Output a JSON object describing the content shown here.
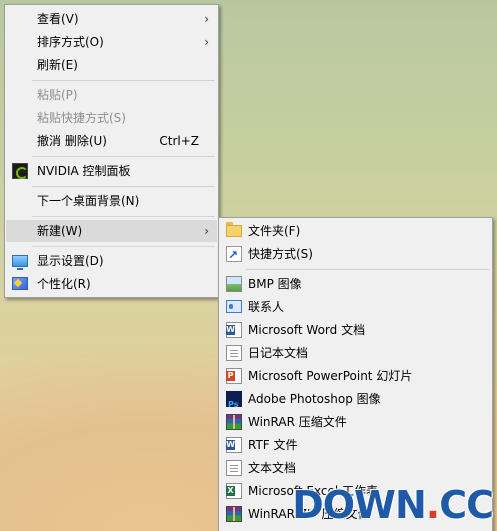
{
  "main_menu": {
    "view": {
      "label": "查看(V)"
    },
    "sort": {
      "label": "排序方式(O)"
    },
    "refresh": {
      "label": "刷新(E)"
    },
    "paste": {
      "label": "粘贴(P)"
    },
    "paste_shortcut": {
      "label": "粘贴快捷方式(S)"
    },
    "undo": {
      "label": "撤消 删除(U)",
      "shortcut": "Ctrl+Z"
    },
    "nvidia": {
      "label": "NVIDIA 控制面板",
      "icon": "nvidia-icon"
    },
    "next_bg": {
      "label": "下一个桌面背景(N)"
    },
    "new": {
      "label": "新建(W)"
    },
    "display": {
      "label": "显示设置(D)",
      "icon": "display-icon"
    },
    "personalize": {
      "label": "个性化(R)",
      "icon": "personalize-icon"
    },
    "submenu_arrow": "›"
  },
  "new_submenu": {
    "folder": {
      "label": "文件夹(F)",
      "icon": "folder-icon"
    },
    "shortcut": {
      "label": "快捷方式(S)",
      "icon": "shortcut-icon"
    },
    "bmp": {
      "label": "BMP 图像",
      "icon": "bmp-image-icon"
    },
    "contact": {
      "label": "联系人",
      "icon": "contact-icon"
    },
    "word": {
      "label": "Microsoft Word 文档",
      "icon": "word-icon"
    },
    "journal": {
      "label": "日记本文档",
      "icon": "journal-icon"
    },
    "ppt": {
      "label": "Microsoft PowerPoint 幻灯片",
      "icon": "powerpoint-icon"
    },
    "photoshop": {
      "label": "Adobe Photoshop 图像",
      "icon": "photoshop-icon"
    },
    "winrar": {
      "label": "WinRAR 压缩文件",
      "icon": "winrar-icon"
    },
    "rtf": {
      "label": "RTF 文件",
      "icon": "rtf-icon"
    },
    "text": {
      "label": "文本文档",
      "icon": "text-document-icon"
    },
    "excel": {
      "label": "Microsoft Excel 工作表",
      "icon": "excel-icon"
    },
    "winrar_zip": {
      "label": "WinRAR ZIP 压缩文件",
      "icon": "winrar-zip-icon"
    }
  },
  "watermark": {
    "text_a": "DOWN",
    "dot": ".",
    "text_b": "CC"
  },
  "colors": {
    "menu_bg": "#f0f0f0",
    "hover_bg": "#dadada",
    "disabled_text": "#8e8e8e",
    "watermark_blue": "#1e5aa8",
    "watermark_red": "#e23b2a"
  }
}
